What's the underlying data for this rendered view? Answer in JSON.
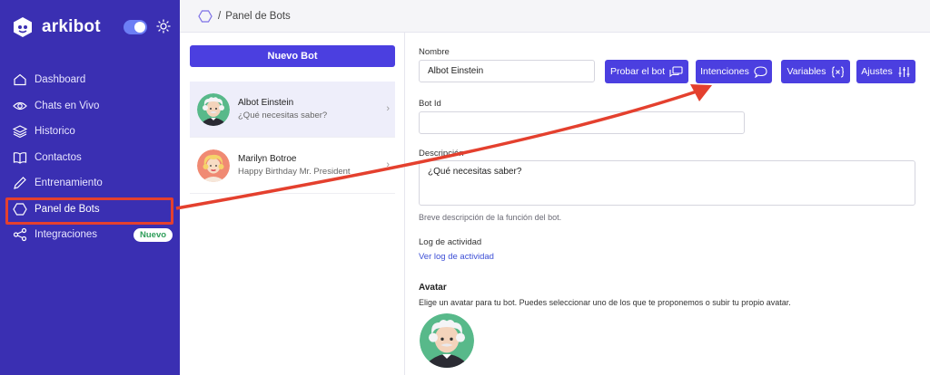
{
  "brand": {
    "name": "arkibot"
  },
  "sidebar": {
    "items": [
      {
        "label": "Dashboard",
        "icon": "home-icon"
      },
      {
        "label": "Chats en Vivo",
        "icon": "eye-icon"
      },
      {
        "label": "Historico",
        "icon": "layers-icon"
      },
      {
        "label": "Contactos",
        "icon": "book-icon"
      },
      {
        "label": "Entrenamiento",
        "icon": "pencil-icon"
      },
      {
        "label": "Panel de Bots",
        "icon": "hexagon-icon",
        "active": true
      },
      {
        "label": "Integraciones",
        "icon": "share-icon",
        "badge": "Nuevo"
      }
    ]
  },
  "breadcrumb": {
    "separator": "/",
    "current": "Panel de Bots"
  },
  "botlist": {
    "new_button": "Nuevo Bot",
    "bots": [
      {
        "name": "Albot Einstein",
        "subtitle": "¿Qué necesitas saber?",
        "selected": true
      },
      {
        "name": "Marilyn Botroe",
        "subtitle": "Happy Birthday Mr. President",
        "selected": false
      }
    ]
  },
  "form": {
    "nombre_label": "Nombre",
    "nombre_value": "Albot Einstein",
    "botid_label": "Bot Id",
    "botid_value": "",
    "descripcion_label": "Descripción",
    "descripcion_value": "¿Qué necesitas saber?",
    "descripcion_help": "Breve descripción de la función del bot.",
    "log_label": "Log de actividad",
    "log_link": "Ver log de actividad",
    "avatar_title": "Avatar",
    "avatar_help": "Elige un avatar para tu bot. Puedes seleccionar uno de los que te proponemos o subir tu propio avatar."
  },
  "actions": {
    "probar": "Probar el bot",
    "intenciones": "Intenciones",
    "variables": "Variables",
    "ajustes": "Ajustes"
  },
  "colors": {
    "sidebar": "#3a2fb2",
    "primary": "#4b3fe0",
    "annotation": "#e4402e",
    "badge_text": "#2f9e5a"
  }
}
